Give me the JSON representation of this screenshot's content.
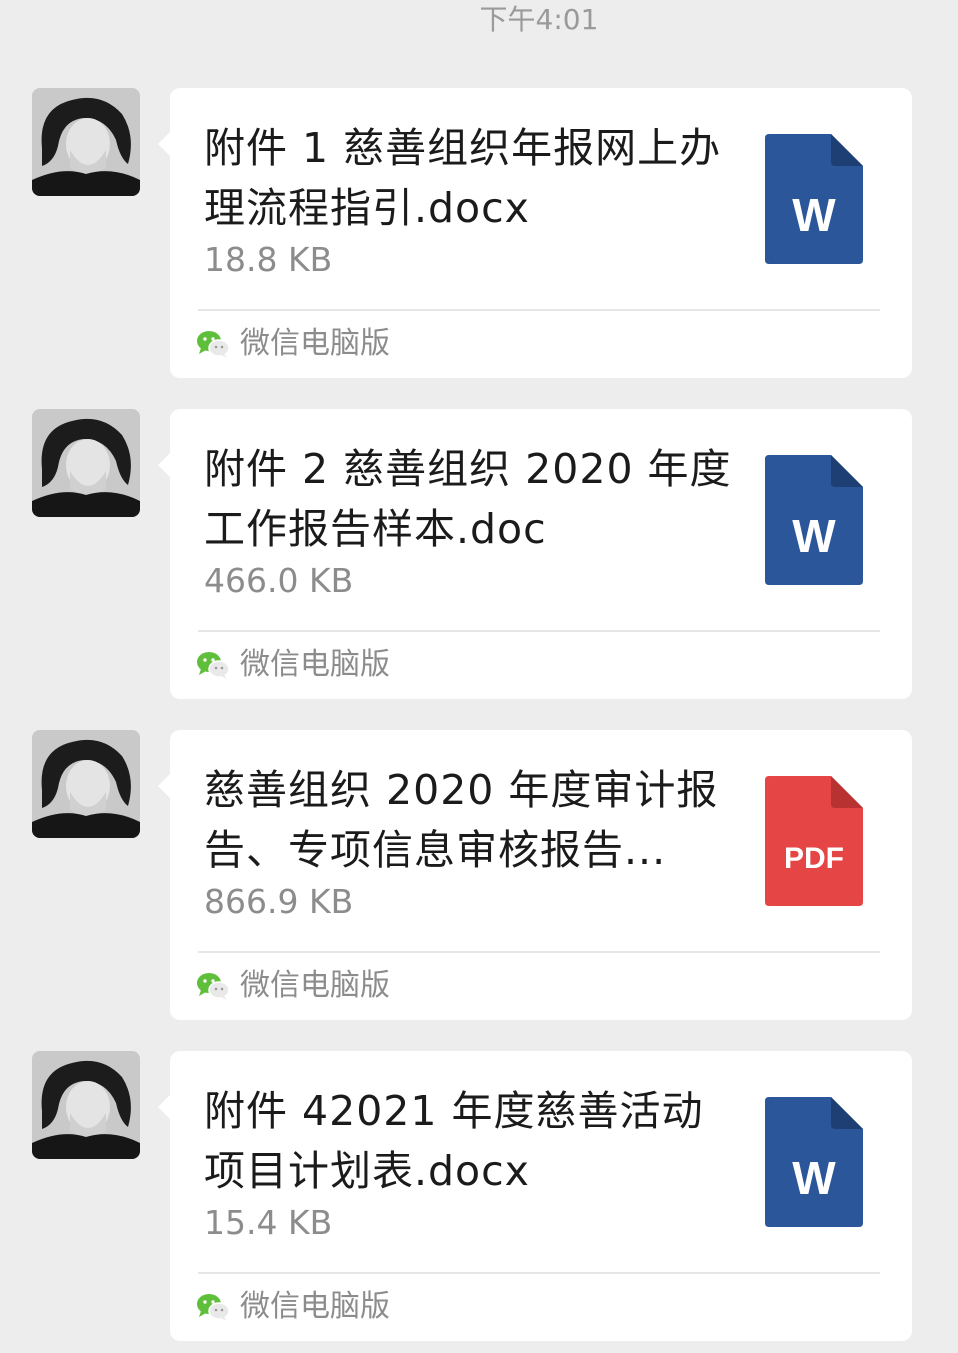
{
  "timestamp": "下午4:01",
  "messages": [
    {
      "file_name": "附件 1 慈善组织年报网上办理流程指引.docx",
      "file_size": "18.8 KB",
      "file_type": "word",
      "icon_label": "W",
      "source_label": "微信电脑版",
      "source_icon": "wechat-icon"
    },
    {
      "file_name": "附件 2 慈善组织 2020 年度工作报告样本.doc",
      "file_size": "466.0 KB",
      "file_type": "word",
      "icon_label": "W",
      "source_label": "微信电脑版",
      "source_icon": "wechat-icon"
    },
    {
      "file_name": "慈善组织 2020 年度审计报告、专项信息审核报告...",
      "file_size": "866.9 KB",
      "file_type": "pdf",
      "icon_label": "PDF",
      "source_label": "微信电脑版",
      "source_icon": "wechat-icon"
    },
    {
      "file_name": "附件 42021 年度慈善活动项目计划表.docx",
      "file_size": "15.4 KB",
      "file_type": "word",
      "icon_label": "W",
      "source_label": "微信电脑版",
      "source_icon": "wechat-icon"
    }
  ],
  "colors": {
    "background": "#ededed",
    "bubble": "#ffffff",
    "word_icon": "#2b579a",
    "word_icon_fold": "#1e3f73",
    "pdf_icon": "#e64545",
    "pdf_icon_fold": "#b83232",
    "wechat_green": "#5fbf3a"
  }
}
